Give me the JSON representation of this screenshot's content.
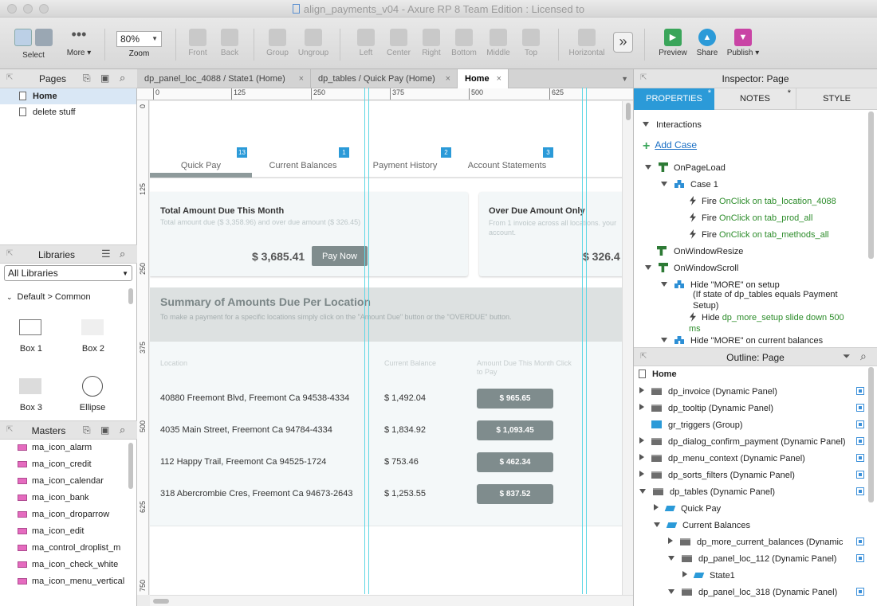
{
  "window": {
    "title": "align_payments_v04 - Axure RP 8 Team Edition : Licensed to"
  },
  "toolbar": {
    "select": "Select",
    "more": "More ▾",
    "zoom_value": "80%",
    "zoom": "Zoom",
    "front": "Front",
    "back": "Back",
    "group": "Group",
    "ungroup": "Ungroup",
    "left": "Left",
    "center": "Center",
    "right": "Right",
    "bottom": "Bottom",
    "middle": "Middle",
    "top": "Top",
    "horizontal": "Horizontal",
    "overflow": "»",
    "preview": "Preview",
    "share": "Share",
    "publish": "Publish ▾"
  },
  "pages": {
    "title": "Pages",
    "items": [
      "Home",
      "delete stuff"
    ]
  },
  "libraries": {
    "title": "Libraries",
    "selected": "All Libraries",
    "group": "Default > Common",
    "items": [
      "Box 1",
      "Box 2",
      "Box 3",
      "Ellipse"
    ]
  },
  "masters": {
    "title": "Masters",
    "items": [
      "ma_icon_alarm",
      "ma_icon_credit",
      "ma_icon_calendar",
      "ma_icon_bank",
      "ma_icon_droparrow",
      "ma_icon_edit",
      "ma_control_droplist_m",
      "ma_icon_check_white",
      "ma_icon_menu_vertical"
    ]
  },
  "tabs": [
    {
      "label": "dp_panel_loc_4088 / State1 (Home)",
      "close": "×"
    },
    {
      "label": "dp_tables / Quick Pay (Home)",
      "close": "×"
    },
    {
      "label": "Home",
      "close": "×"
    }
  ],
  "ruler": {
    "h": [
      "0",
      "125",
      "250",
      "375",
      "500",
      "625"
    ],
    "v": [
      "0",
      "125",
      "250",
      "375",
      "500",
      "625",
      "750"
    ]
  },
  "design": {
    "nav": [
      {
        "label": "Quick Pay",
        "badge": "13"
      },
      {
        "label": "Current Balances",
        "badge": "1"
      },
      {
        "label": "Payment History",
        "badge": "2"
      },
      {
        "label": "Account Statements",
        "badge": "3"
      }
    ],
    "card1": {
      "title": "Total Amount Due This Month",
      "subtitle": "Total amount due ($ 3,358.96) and over due amount ($ 326.45)",
      "amount": "$ 3,685.41",
      "button": "Pay Now"
    },
    "card2": {
      "title": "Over Due Amount Only",
      "subtitle": "From 1 invoice across all locations. your account.",
      "amount": "$ 326.4"
    },
    "summary": {
      "title": "Summary of Amounts Due Per Location",
      "subtitle": "To make a payment for a specific locations simply click on the \"Amount Due\" button or the \"OVERDUE\" button."
    },
    "table": {
      "headers": [
        "Location",
        "Current Balance",
        "Amount Due This Month Click to Pay"
      ],
      "rows": [
        {
          "location": "40880 Freemont Blvd, Freemont Ca 94538-4334",
          "balance": "$ 1,492.04",
          "due": "$ 965.65"
        },
        {
          "location": "4035 Main Street, Freemont Ca 94784-4334",
          "balance": "$ 1,834.92",
          "due": "$ 1,093.45"
        },
        {
          "location": "112 Happy Trail, Freemont Ca 94525-1724",
          "balance": "$ 753.46",
          "due": "$ 462.34"
        },
        {
          "location": "318 Abercrombie Cres, Freemont Ca 94673-2643",
          "balance": "$ 1,253.55",
          "due": "$ 837.52"
        }
      ]
    }
  },
  "inspector": {
    "title": "Inspector: Page",
    "tabs": [
      "PROPERTIES",
      "NOTES",
      "STYLE"
    ],
    "tab_marks": [
      "*",
      "*"
    ],
    "interactions": "Interactions",
    "add_case": "Add Case",
    "events": {
      "onpageload": "OnPageLoad",
      "case1": "Case 1",
      "fire": "Fire",
      "f1": "OnClick on tab_location_4088",
      "f2": "OnClick on tab_prod_all",
      "f3": "OnClick on tab_methods_all",
      "onresize": "OnWindowResize",
      "onscroll": "OnWindowScroll",
      "hide1": "Hide \"MORE\" on setup",
      "hide1_cond": "(If state of dp_tables equals Payment Setup)",
      "hide": "Hide",
      "hide_action": "dp_more_setup slide down 500 ms",
      "hide2": "Hide \"MORE\" on current balances"
    }
  },
  "outline": {
    "title": "Outline: Page",
    "root": "Home",
    "items": [
      "dp_invoice (Dynamic Panel)",
      "dp_tooltip (Dynamic Panel)",
      "gr_triggers (Group)",
      "dp_dialog_confirm_payment (Dynamic Panel)",
      "dp_menu_context (Dynamic Panel)",
      "dp_sorts_filters (Dynamic Panel)",
      "dp_tables (Dynamic Panel)",
      "Quick Pay",
      "Current Balances",
      "dp_more_current_balances (Dynamic",
      "dp_panel_loc_112 (Dynamic Panel)",
      "State1",
      "dp_panel_loc_318 (Dynamic Panel)"
    ]
  },
  "colors": {
    "accent": "#2b9ad8",
    "pay_button": "#7f8c8d",
    "link_green": "#2c8c2a"
  }
}
